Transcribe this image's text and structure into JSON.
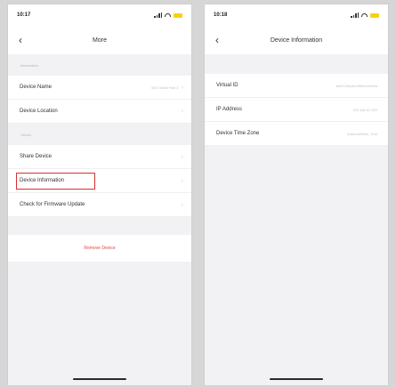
{
  "left": {
    "status_time": "10:17",
    "nav_title": "More",
    "back_icon": "chevron-left-icon",
    "group_info_label": "Information",
    "device_name_label": "Device Name",
    "device_name_value": "BLE Mesh Hub 2",
    "device_location_label": "Device Location",
    "group_others_label": "Others",
    "share_device_label": "Share Device",
    "device_information_label": "Device Information",
    "firmware_update_label": "Check for Firmware Update",
    "remove_device_label": "Remove Device"
  },
  "right": {
    "status_time": "10:18",
    "nav_title": "Device Information",
    "back_icon": "chevron-left-icon",
    "rows": [
      {
        "label": "Virtual ID",
        "value": "ae01234cab23ffeeeeeeea"
      },
      {
        "label": "IP Address",
        "value": "192.168.31.220"
      },
      {
        "label": "Device Time Zone",
        "value": "America/New_York"
      }
    ]
  },
  "colors": {
    "highlight": "#d93030",
    "remove_text": "#e24848",
    "battery": "#f5d300"
  }
}
